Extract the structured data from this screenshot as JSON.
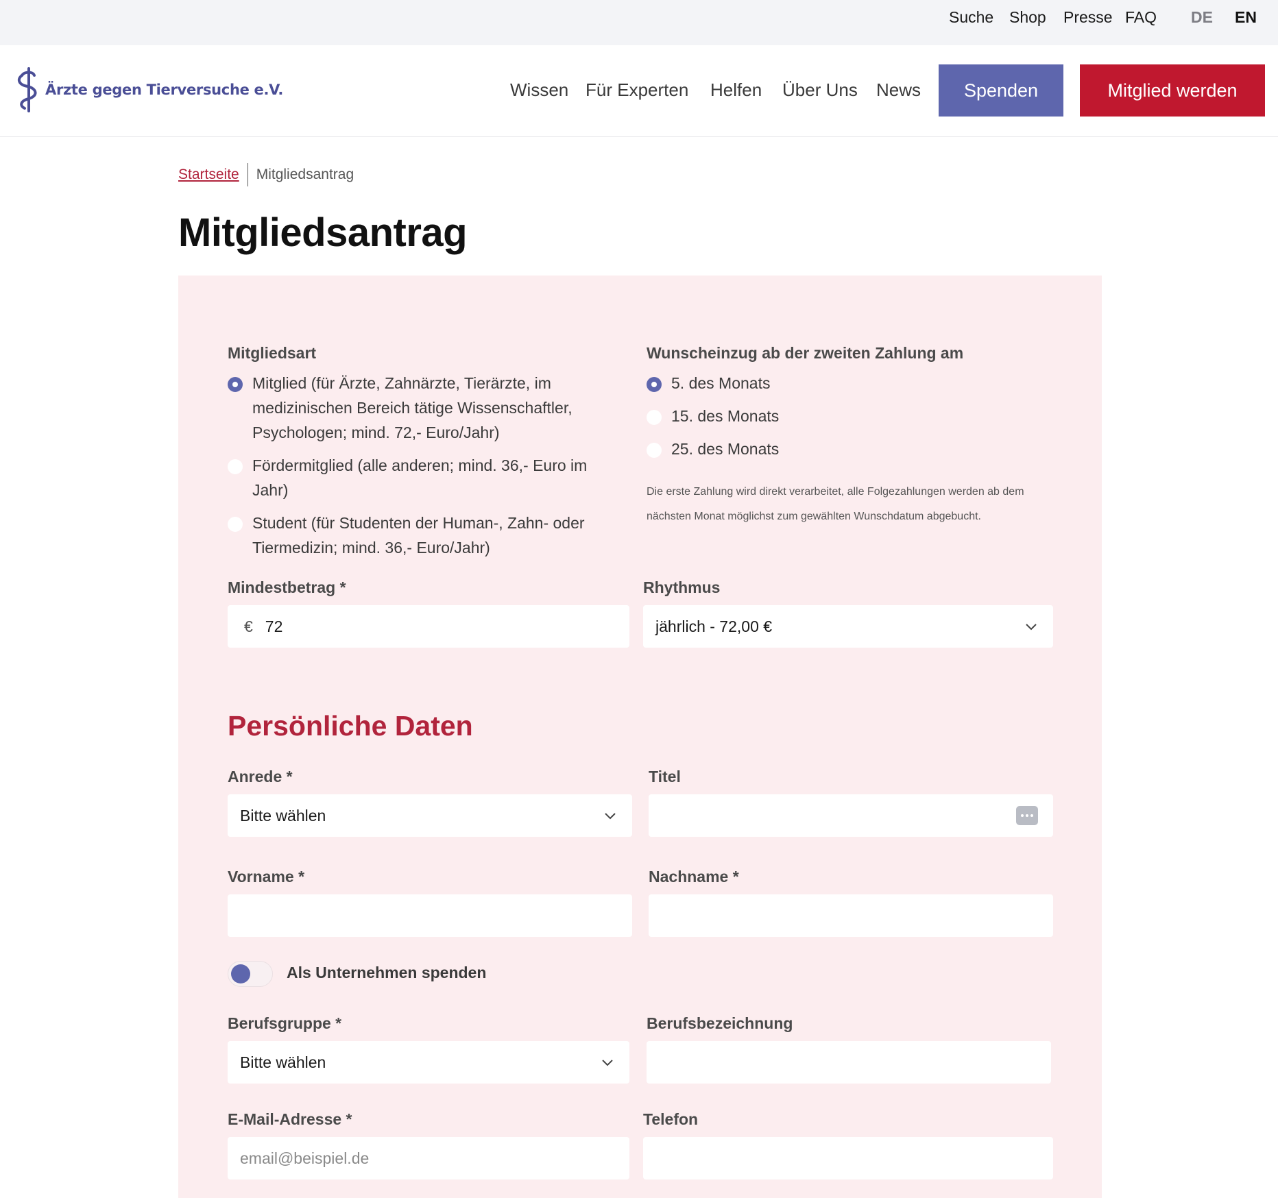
{
  "topbar": {
    "links": [
      "Suche",
      "Shop",
      "Presse",
      "FAQ"
    ],
    "lang_de": "DE",
    "lang_en": "EN"
  },
  "header": {
    "logo_text": "Ärzte gegen Tierversuche e.V.",
    "nav": [
      "Wissen",
      "Für Experten",
      "Helfen",
      "Über Uns",
      "News"
    ],
    "donate_label": "Spenden",
    "member_label": "Mitglied werden",
    "colors": {
      "donate": "#5e66ad",
      "member": "#c0182f"
    }
  },
  "breadcrumb": {
    "home": "Startseite",
    "current": "Mitgliedsantrag"
  },
  "page_title": "Mitgliedsantrag",
  "form": {
    "membership": {
      "label": "Mitgliedsart",
      "options": [
        {
          "text": "Mitglied (für Ärzte, Zahnärzte, Tierärzte, im medizinischen Bereich tätige Wissenschaftler, Psychologen; mind. 72,- Euro/Jahr)",
          "checked": true
        },
        {
          "text": "Fördermitglied (alle anderen; mind. 36,- Euro im Jahr)",
          "checked": false
        },
        {
          "text": "Student (für Studenten der Human-, Zahn- oder Tiermedizin; mind. 36,- Euro/Jahr)",
          "checked": false
        }
      ]
    },
    "debit_day": {
      "label": "Wunscheinzug ab der zweiten Zahlung am",
      "options": [
        {
          "text": "5. des Monats",
          "checked": true
        },
        {
          "text": "15. des Monats",
          "checked": false
        },
        {
          "text": "25. des Monats",
          "checked": false
        }
      ],
      "hint": "Die erste Zahlung wird direkt verarbeitet, alle Folgezahlungen werden ab dem nächsten Monat möglichst zum gewählten Wunschdatum abgebucht."
    },
    "min_amount": {
      "label": "Mindestbetrag *",
      "currency": "€",
      "value": "72"
    },
    "rhythm": {
      "label": "Rhythmus",
      "value": "jährlich - 72,00 €"
    },
    "personal_title": "Persönliche Daten",
    "salutation": {
      "label": "Anrede *",
      "value": "Bitte wählen"
    },
    "title_field": {
      "label": "Titel",
      "value": ""
    },
    "first_name": {
      "label": "Vorname *",
      "value": ""
    },
    "last_name": {
      "label": "Nachname *",
      "value": ""
    },
    "company_toggle": {
      "label": "Als Unternehmen spenden",
      "on": false
    },
    "profession_group": {
      "label": "Berufsgruppe *",
      "value": "Bitte wählen"
    },
    "profession": {
      "label": "Berufsbezeichnung",
      "value": ""
    },
    "email": {
      "label": "E-Mail-Adresse *",
      "placeholder": "email@beispiel.de"
    },
    "phone": {
      "label": "Telefon",
      "value": ""
    }
  }
}
